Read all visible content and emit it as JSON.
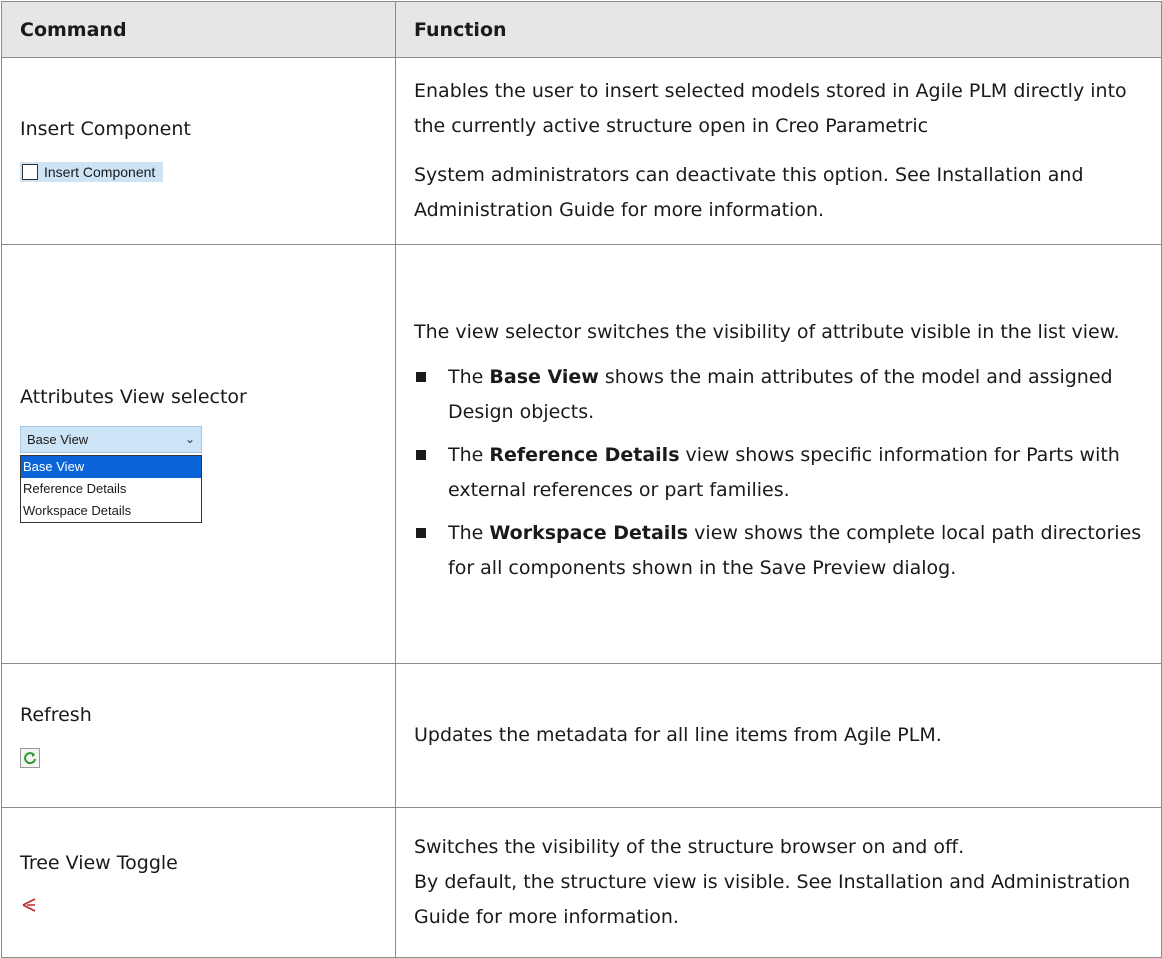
{
  "table": {
    "header": {
      "command": "Command",
      "function": "Function"
    },
    "rows": [
      {
        "command": "Insert Component",
        "widget_label": "Insert Component",
        "function_p1": "Enables the user to insert selected models stored in Agile PLM directly into the currently active structure open in Creo Parametric",
        "function_p2": "System administrators can deactivate this option. See Installation and Administration Guide for more information."
      },
      {
        "command": "Attributes View selector",
        "selector": {
          "selected": "Base View",
          "options": [
            "Base View",
            "Reference Details",
            "Workspace Details"
          ]
        },
        "function_intro": "The view selector switches the visibility of attribute visible in the list view.",
        "bullets": [
          {
            "prefix": "The ",
            "bold": "Base View",
            "rest": " shows the main attributes of the model and assigned Design objects."
          },
          {
            "prefix": "The ",
            "bold": "Reference Details",
            "rest": " view shows specific information for Parts with external references or part families."
          },
          {
            "prefix": "The ",
            "bold": "Workspace Details",
            "rest": " view shows the complete local path directories for all components shown in the Save Preview dialog."
          }
        ]
      },
      {
        "command": "Refresh",
        "icon": "refresh-icon",
        "function": "Updates the metadata for all line items from Agile PLM."
      },
      {
        "command": "Tree View Toggle",
        "icon": "tree-icon",
        "function_line1": "Switches the visibility of the structure browser on and off.",
        "function_line2": "By default, the structure view is visible. See Installation and Administration Guide for more information."
      }
    ]
  }
}
